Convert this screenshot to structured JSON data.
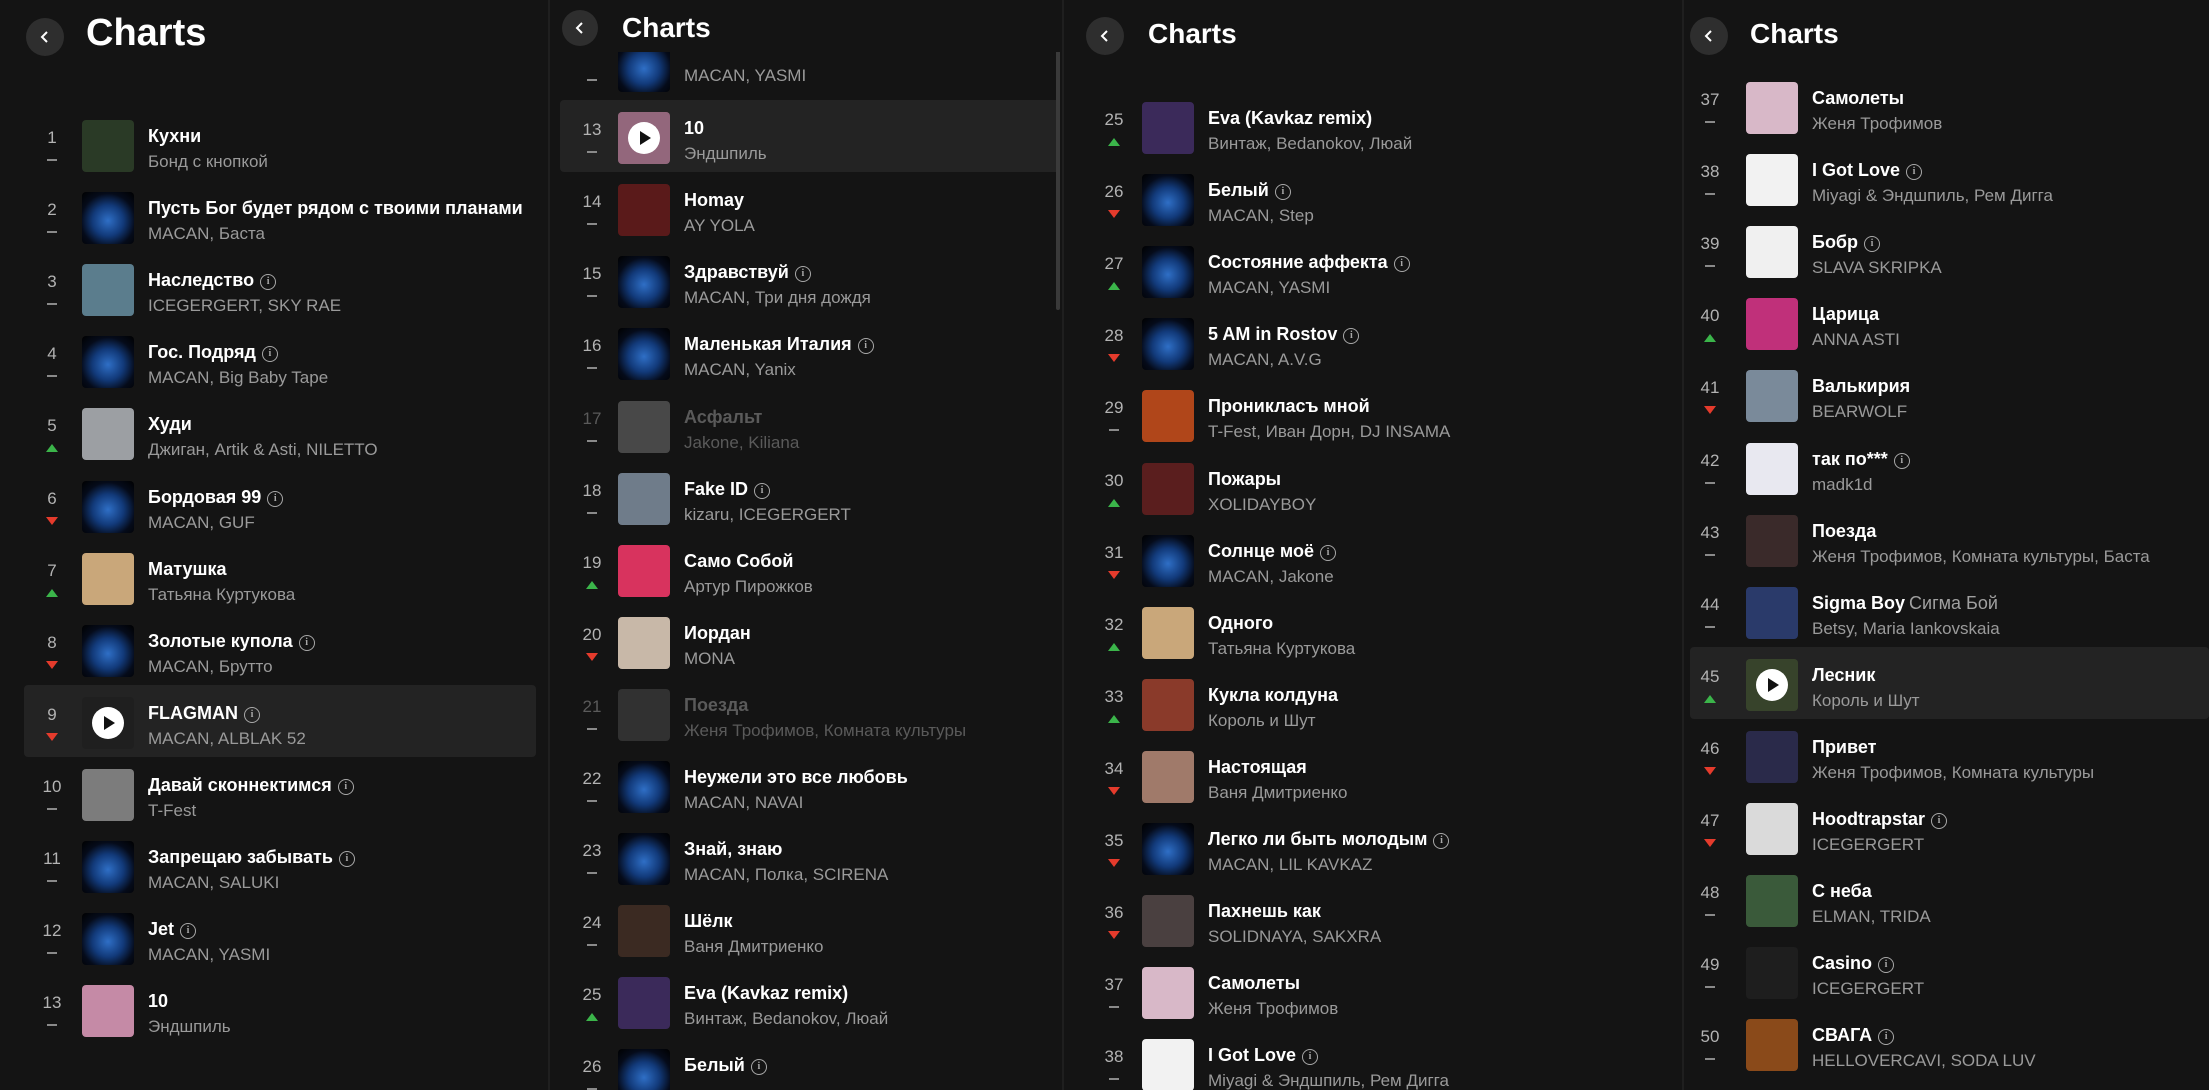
{
  "app_title": "Charts",
  "icons": {
    "back": "chevron-left-icon",
    "info": "info-icon",
    "play": "play-icon"
  },
  "colors": {
    "up": "#3bb54a",
    "down": "#e53b2c",
    "background": "#141414"
  },
  "panels": [
    {
      "id": "p1",
      "title": "Charts",
      "tracks": [
        {
          "rank": "1",
          "title": "Кухни",
          "artist": "Бонд с кнопкой",
          "trend": "same",
          "info": false,
          "cover": "#2a3a26"
        },
        {
          "rank": "2",
          "title": "Пусть Бог будет рядом с твоими планами",
          "artist": "MACAN, Баста",
          "trend": "same",
          "info": false,
          "cover": "bratland"
        },
        {
          "rank": "3",
          "title": "Наследство",
          "artist": "ICEGERGERT, SKY RAE",
          "trend": "same",
          "info": true,
          "cover": "#5b7d8d"
        },
        {
          "rank": "4",
          "title": "Гос. Подряд",
          "artist": "MACAN, Big Baby Tape",
          "trend": "same",
          "info": true,
          "cover": "bratland"
        },
        {
          "rank": "5",
          "title": "Худи",
          "artist": "Джиган, Artik & Asti, NILETTO",
          "trend": "up",
          "info": false,
          "cover": "#9c9fa3"
        },
        {
          "rank": "6",
          "title": "Бордовая 99",
          "artist": "MACAN, GUF",
          "trend": "down",
          "info": true,
          "cover": "bratland"
        },
        {
          "rank": "7",
          "title": "Матушка",
          "artist": "Татьяна Куртукова",
          "trend": "up",
          "info": false,
          "cover": "#c9a77a"
        },
        {
          "rank": "8",
          "title": "Золотые купола",
          "artist": "MACAN, Брутто",
          "trend": "down",
          "info": true,
          "cover": "bratland"
        },
        {
          "rank": "9",
          "title": "FLAGMAN",
          "artist": "MACAN, ALBLAK 52",
          "trend": "down",
          "info": true,
          "cover": "#2a2a2a",
          "highlight": true,
          "play": true
        },
        {
          "rank": "10",
          "title": "Давай сконнектимся",
          "artist": "T-Fest",
          "trend": "same",
          "info": true,
          "cover": "#7c7c7c"
        },
        {
          "rank": "11",
          "title": "Запрещаю забывать",
          "artist": "MACAN, SALUKI",
          "trend": "same",
          "info": true,
          "cover": "bratland"
        },
        {
          "rank": "12",
          "title": "Jet",
          "artist": "MACAN, YASMI",
          "trend": "same",
          "info": true,
          "cover": "bratland"
        },
        {
          "rank": "13",
          "title": "10",
          "artist": "Эндшпиль",
          "trend": "same",
          "info": false,
          "cover": "#c58aa6"
        }
      ]
    },
    {
      "id": "p2",
      "title": "Charts",
      "tracks": [
        {
          "rank": "",
          "title": "",
          "artist": "MACAN, YASMI",
          "trend": "same",
          "info": false,
          "cover": "bratland",
          "partial": true
        },
        {
          "rank": "13",
          "title": "10",
          "artist": "Эндшпиль",
          "trend": "same",
          "info": false,
          "cover": "#c58aa6",
          "highlight": true,
          "play": true
        },
        {
          "rank": "14",
          "title": "Homay",
          "artist": "AY YOLA",
          "trend": "same",
          "info": false,
          "cover": "#5a1a1a"
        },
        {
          "rank": "15",
          "title": "Здравствуй",
          "artist": "MACAN, Три дня дождя",
          "trend": "same",
          "info": true,
          "cover": "bratland"
        },
        {
          "rank": "16",
          "title": "Маленькая Италия",
          "artist": "MACAN, Yanix",
          "trend": "same",
          "info": true,
          "cover": "bratland"
        },
        {
          "rank": "17",
          "title": "Асфальт",
          "artist": "Jakone, Kiliana",
          "trend": "same",
          "info": false,
          "cover": "#888888",
          "dim": true
        },
        {
          "rank": "18",
          "title": "Fake ID",
          "artist": "kizaru, ICEGERGERT",
          "trend": "same",
          "info": true,
          "cover": "#6f7c8a"
        },
        {
          "rank": "19",
          "title": "Само Собой",
          "artist": "Артур Пирожков",
          "trend": "up",
          "info": false,
          "cover": "#d8335e"
        },
        {
          "rank": "20",
          "title": "Иордан",
          "artist": "MONA",
          "trend": "down",
          "info": false,
          "cover": "#c8b8a8"
        },
        {
          "rank": "21",
          "title": "Поезда",
          "artist": "Женя Трофимов, Комната культуры",
          "trend": "same",
          "info": false,
          "cover": "#555555",
          "dim": true
        },
        {
          "rank": "22",
          "title": "Неужели это все любовь",
          "artist": "MACAN, NAVAI",
          "trend": "same",
          "info": false,
          "cover": "bratland"
        },
        {
          "rank": "23",
          "title": "Знай, знаю",
          "artist": "MACAN, Полка, SCIRENA",
          "trend": "same",
          "info": false,
          "cover": "bratland"
        },
        {
          "rank": "24",
          "title": "Шёлк",
          "artist": "Ваня Дмитриенко",
          "trend": "same",
          "info": false,
          "cover": "#3b2a22"
        },
        {
          "rank": "25",
          "title": "Eva (Kavkaz remix)",
          "artist": "Винтаж, Bedanokov, Люай",
          "trend": "up",
          "info": false,
          "cover": "#3b2a5a"
        },
        {
          "rank": "26",
          "title": "Белый",
          "artist": "",
          "trend": "same",
          "info": true,
          "cover": "bratland"
        }
      ]
    },
    {
      "id": "p3",
      "title": "Charts",
      "tracks": [
        {
          "rank": "25",
          "title": "Eva (Kavkaz remix)",
          "artist": "Винтаж, Bedanokov, Люай",
          "trend": "up",
          "info": false,
          "cover": "#3b2a5a"
        },
        {
          "rank": "26",
          "title": "Белый",
          "artist": "MACAN, Step",
          "trend": "down",
          "info": true,
          "cover": "bratland"
        },
        {
          "rank": "27",
          "title": "Состояние аффекта",
          "artist": "MACAN, YASMI",
          "trend": "up",
          "info": true,
          "cover": "bratland"
        },
        {
          "rank": "28",
          "title": "5 AM in Rostov",
          "artist": "MACAN, A.V.G",
          "trend": "down",
          "info": true,
          "cover": "bratland"
        },
        {
          "rank": "29",
          "title": "Проникласъ мной",
          "artist": "T-Fest, Иван Дорн, DJ INSAMA",
          "trend": "same",
          "info": false,
          "cover": "#b0461a"
        },
        {
          "rank": "30",
          "title": "Пожары",
          "artist": "XOLIDAYBOY",
          "trend": "up",
          "info": false,
          "cover": "#5a1e1e"
        },
        {
          "rank": "31",
          "title": "Солнце моё",
          "artist": "MACAN, Jakone",
          "trend": "down",
          "info": true,
          "cover": "bratland"
        },
        {
          "rank": "32",
          "title": "Одного",
          "artist": "Татьяна Куртукова",
          "trend": "up",
          "info": false,
          "cover": "#c9a77a"
        },
        {
          "rank": "33",
          "title": "Кукла колдуна",
          "artist": "Король и Шут",
          "trend": "up",
          "info": false,
          "cover": "#8a3a2a"
        },
        {
          "rank": "34",
          "title": "Настоящая",
          "artist": "Ваня Дмитриенко",
          "trend": "down",
          "info": false,
          "cover": "#a07a6a"
        },
        {
          "rank": "35",
          "title": "Легко ли быть молодым",
          "artist": "MACAN, LIL KAVKAZ",
          "trend": "down",
          "info": true,
          "cover": "bratland"
        },
        {
          "rank": "36",
          "title": "Пахнешь как",
          "artist": "SOLIDNAYA, SAKXRA",
          "trend": "down",
          "info": false,
          "cover": "#4a4040"
        },
        {
          "rank": "37",
          "title": "Самолеты",
          "artist": "Женя Трофимов",
          "trend": "same",
          "info": false,
          "cover": "#d8b8c8"
        },
        {
          "rank": "38",
          "title": "I Got Love",
          "artist": "Miyagi & Эндшпиль, Рем Дигга",
          "trend": "same",
          "info": true,
          "cover": "#f2f2f2"
        }
      ]
    },
    {
      "id": "p4",
      "title": "Charts",
      "tracks": [
        {
          "rank": "37",
          "title": "Самолеты",
          "artist": "Женя Трофимов",
          "trend": "same",
          "info": false,
          "cover": "#d8b8c8"
        },
        {
          "rank": "38",
          "title": "I Got Love",
          "artist": "Miyagi & Эндшпиль, Рем Дигга",
          "trend": "same",
          "info": true,
          "cover": "#f2f2f2"
        },
        {
          "rank": "39",
          "title": "Бобр",
          "artist": "SLAVA SKRIPKA",
          "trend": "same",
          "info": true,
          "cover": "#f0f0f0"
        },
        {
          "rank": "40",
          "title": "Царица",
          "artist": "ANNA ASTI",
          "trend": "up",
          "info": false,
          "cover": "#c0307a"
        },
        {
          "rank": "41",
          "title": "Валькирия",
          "artist": "BEARWOLF",
          "trend": "down",
          "info": false,
          "cover": "#7a8a9a"
        },
        {
          "rank": "42",
          "title": "так по***",
          "artist": "madk1d",
          "trend": "same",
          "info": true,
          "cover": "#e8e8f0"
        },
        {
          "rank": "43",
          "title": "Поезда",
          "artist": "Женя Трофимов, Комната культуры, Баста",
          "trend": "same",
          "info": false,
          "cover": "#3a2a2a"
        },
        {
          "rank": "44",
          "title": "Sigma Boy",
          "subtitle": "Сигма Бой",
          "artist": "Betsy, Maria Iankovskaia",
          "trend": "same",
          "info": false,
          "cover": "#2a3a6a"
        },
        {
          "rank": "45",
          "title": "Лесник",
          "artist": "Король и Шут",
          "trend": "up",
          "info": false,
          "cover": "#4a5a3a",
          "highlight": true,
          "play": true
        },
        {
          "rank": "46",
          "title": "Привет",
          "artist": "Женя Трофимов, Комната культуры",
          "trend": "down",
          "info": false,
          "cover": "#2a2a4a"
        },
        {
          "rank": "47",
          "title": "Hoodtrapstar",
          "artist": "ICEGERGERT",
          "trend": "down",
          "info": true,
          "cover": "#dadada"
        },
        {
          "rank": "48",
          "title": "С неба",
          "artist": "ELMAN, TRIDA",
          "trend": "same",
          "info": false,
          "cover": "#3a5a3a"
        },
        {
          "rank": "49",
          "title": "Casino",
          "artist": "ICEGERGERT",
          "trend": "same",
          "info": true,
          "cover": "#1e1e1e"
        },
        {
          "rank": "50",
          "title": "СВАГА",
          "artist": "HELLOVERCAVI, SODA LUV",
          "trend": "same",
          "info": true,
          "cover": "#8a4a1a"
        }
      ]
    }
  ]
}
